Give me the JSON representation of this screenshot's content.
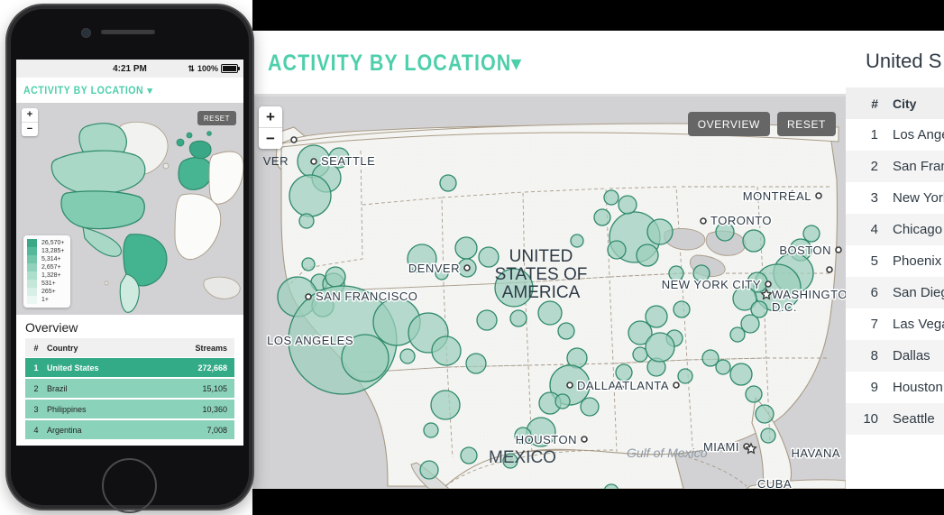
{
  "desktop": {
    "title": "ACTIVITY BY LOCATION",
    "title_chevron": "chevron-down-icon",
    "map_buttons": {
      "overview": "OVERVIEW",
      "reset": "RESET"
    },
    "zoom_in": "+",
    "zoom_out": "−",
    "list": {
      "title": "United S",
      "columns": [
        "#",
        "City"
      ],
      "rows": [
        {
          "rank": "1",
          "city": "Los Angeles"
        },
        {
          "rank": "2",
          "city": "San Francisco"
        },
        {
          "rank": "3",
          "city": "New York City"
        },
        {
          "rank": "4",
          "city": "Chicago"
        },
        {
          "rank": "5",
          "city": "Phoenix"
        },
        {
          "rank": "6",
          "city": "San Diego"
        },
        {
          "rank": "7",
          "city": "Las Vegas"
        },
        {
          "rank": "8",
          "city": "Dallas"
        },
        {
          "rank": "9",
          "city": "Houston"
        },
        {
          "rank": "10",
          "city": "Seattle"
        }
      ]
    },
    "map_labels": [
      "VER",
      "SEATTLE",
      "DENVER",
      "UNITED",
      "STATES OF",
      "AMERICA",
      "MONTRÉAL",
      "TORONTO",
      "BOSTON",
      "NEW YORK CITY",
      "WASHINGTON",
      "D.C.",
      "SAN FRANCISCO",
      "LOS ANGELES",
      "DALLAS",
      "HOUSTON",
      "ATLANTA",
      "MIAMI",
      "Gulf of Mexico",
      "HAVANA",
      "CUBA",
      "MEXICO"
    ]
  },
  "phone": {
    "status": {
      "time": "4:21 PM",
      "bluetooth": "bluetooth-icon",
      "battery_percent": "100%"
    },
    "title": "ACTIVITY BY LOCATION",
    "title_chevron": "chevron-down-icon",
    "reset": "RESET",
    "zoom_in": "+",
    "zoom_out": "−",
    "legend": {
      "labels": [
        "26,570+",
        "13,285+",
        "5,314+",
        "2,657+",
        "1,328+",
        "531+",
        "265+",
        "1+"
      ],
      "colors": [
        "#3aa886",
        "#56b89a",
        "#74c6ab",
        "#92d2bc",
        "#aedecc",
        "#c4e7da",
        "#d8efe7",
        "#eaf7f2"
      ]
    },
    "overview": {
      "heading": "Overview",
      "columns": [
        "#",
        "Country",
        "Streams"
      ],
      "rows": [
        {
          "rank": "1",
          "country": "United States",
          "streams": "272,668"
        },
        {
          "rank": "2",
          "country": "Brazil",
          "streams": "15,105"
        },
        {
          "rank": "3",
          "country": "Philippines",
          "streams": "10,360"
        },
        {
          "rank": "4",
          "country": "Argentina",
          "streams": "7,008"
        }
      ]
    }
  },
  "colors": {
    "accent_green": "#4ecfab",
    "bubble_fill": "#9ccfbd",
    "bubble_stroke": "#2f8a6c",
    "row_top": "#34ab87",
    "row_alt": "#8bd2ba",
    "map_water": "#d2d2d4",
    "map_land": "#f4f4f2",
    "button_gray": "#666666"
  }
}
